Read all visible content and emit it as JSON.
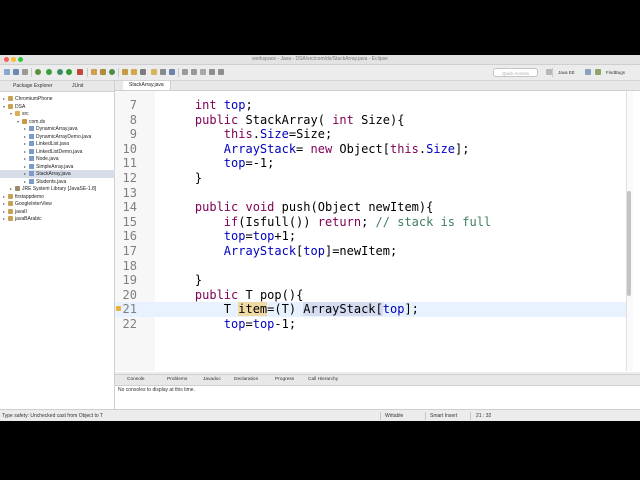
{
  "window": {
    "title": "workspace - Java - DSA/src/com/ds/StackArray.java - Eclipse",
    "quick_access_placeholder": "Quick Access",
    "perspectives": [
      "Java EE",
      "FindBugs"
    ]
  },
  "explorer": {
    "tabs": [
      "Package Explorer",
      "JUnit"
    ],
    "tree": [
      {
        "label": "ChromiumPhone",
        "level": 0,
        "kind": "project"
      },
      {
        "label": "DSA",
        "level": 0,
        "kind": "project"
      },
      {
        "label": "src",
        "level": 1,
        "kind": "folder"
      },
      {
        "label": "com.ds",
        "level": 2,
        "kind": "package"
      },
      {
        "label": "DynamicArray.java",
        "level": 3,
        "kind": "file"
      },
      {
        "label": "DynamicArrayDemo.java",
        "level": 3,
        "kind": "file"
      },
      {
        "label": "LinkedList.java",
        "level": 3,
        "kind": "file"
      },
      {
        "label": "LinkedListDemo.java",
        "level": 3,
        "kind": "file"
      },
      {
        "label": "Node.java",
        "level": 3,
        "kind": "file"
      },
      {
        "label": "SimpleArray.java",
        "level": 3,
        "kind": "file"
      },
      {
        "label": "StackArray.java",
        "level": 3,
        "kind": "file",
        "selected": true
      },
      {
        "label": "Students.java",
        "level": 3,
        "kind": "file"
      },
      {
        "label": "JRE System Library [JavaSE-1.8]",
        "level": 1,
        "kind": "library"
      },
      {
        "label": "firstappdemo",
        "level": 0,
        "kind": "project"
      },
      {
        "label": "GoogleInterView",
        "level": 0,
        "kind": "project"
      },
      {
        "label": "javaII",
        "level": 0,
        "kind": "project"
      },
      {
        "label": "javaBArabic",
        "level": 0,
        "kind": "project"
      }
    ]
  },
  "editor": {
    "tab": "StackArray.java",
    "lines": [
      {
        "n": "7",
        "code": [
          {
            "t": "    "
          },
          {
            "t": "int",
            "c": "kw"
          },
          {
            "t": " "
          },
          {
            "t": "top",
            "c": "fld"
          },
          {
            "t": ";"
          }
        ]
      },
      {
        "n": "8",
        "code": [
          {
            "t": "    "
          },
          {
            "t": "public",
            "c": "kw"
          },
          {
            "t": " StackArray( "
          },
          {
            "t": "int",
            "c": "kw"
          },
          {
            "t": " Size){"
          }
        ]
      },
      {
        "n": "9",
        "code": [
          {
            "t": "        "
          },
          {
            "t": "this",
            "c": "kw"
          },
          {
            "t": "."
          },
          {
            "t": "Size",
            "c": "fld"
          },
          {
            "t": "=Size;"
          }
        ]
      },
      {
        "n": "10",
        "code": [
          {
            "t": "        "
          },
          {
            "t": "ArrayStack",
            "c": "fld"
          },
          {
            "t": "= "
          },
          {
            "t": "new",
            "c": "kw"
          },
          {
            "t": " Object["
          },
          {
            "t": "this",
            "c": "kw"
          },
          {
            "t": "."
          },
          {
            "t": "Size",
            "c": "fld"
          },
          {
            "t": "];"
          }
        ]
      },
      {
        "n": "11",
        "code": [
          {
            "t": "        "
          },
          {
            "t": "top",
            "c": "fld"
          },
          {
            "t": "=-1;"
          }
        ]
      },
      {
        "n": "12",
        "code": [
          {
            "t": "    }"
          }
        ]
      },
      {
        "n": "13",
        "code": [
          {
            "t": ""
          }
        ]
      },
      {
        "n": "14",
        "code": [
          {
            "t": "    "
          },
          {
            "t": "public",
            "c": "kw"
          },
          {
            "t": " "
          },
          {
            "t": "void",
            "c": "kw"
          },
          {
            "t": " push(Object newItem){"
          }
        ]
      },
      {
        "n": "15",
        "code": [
          {
            "t": "        "
          },
          {
            "t": "if",
            "c": "kw"
          },
          {
            "t": "(Isfull()) "
          },
          {
            "t": "return",
            "c": "kw"
          },
          {
            "t": "; "
          },
          {
            "t": "// stack is full",
            "c": "cmt"
          }
        ]
      },
      {
        "n": "16",
        "code": [
          {
            "t": "        "
          },
          {
            "t": "top",
            "c": "fld"
          },
          {
            "t": "="
          },
          {
            "t": "top",
            "c": "fld"
          },
          {
            "t": "+1;"
          }
        ]
      },
      {
        "n": "17",
        "code": [
          {
            "t": "        "
          },
          {
            "t": "ArrayStack",
            "c": "fld"
          },
          {
            "t": "["
          },
          {
            "t": "top",
            "c": "fld"
          },
          {
            "t": "]=newItem;"
          }
        ]
      },
      {
        "n": "18",
        "code": [
          {
            "t": ""
          }
        ]
      },
      {
        "n": "19",
        "code": [
          {
            "t": "    }"
          }
        ]
      },
      {
        "n": "20",
        "code": [
          {
            "t": "    "
          },
          {
            "t": "public",
            "c": "kw"
          },
          {
            "t": " T pop(){"
          }
        ]
      },
      {
        "n": "21",
        "current": true,
        "code": [
          {
            "t": "        T "
          },
          {
            "t": "item",
            "c": "var-hl"
          },
          {
            "t": "=(T) "
          },
          {
            "t": "ArrayStack[",
            "c": "arr-hl"
          },
          {
            "t": "top",
            "c": "fld"
          },
          {
            "t": "];"
          }
        ]
      },
      {
        "n": "22",
        "code": [
          {
            "t": "        "
          },
          {
            "t": "top",
            "c": "fld"
          },
          {
            "t": "="
          },
          {
            "t": "top",
            "c": "fld"
          },
          {
            "t": "-1;"
          }
        ]
      }
    ]
  },
  "console": {
    "tabs": [
      "Console",
      "Problems",
      "Javadoc",
      "Declaration",
      "Progress",
      "Call Hierarchy"
    ],
    "message": "No consoles to display at this time."
  },
  "status": {
    "message": "Type safety: Unchecked cast from Object to T",
    "writable": "Writable",
    "insert_mode": "Smart Insert",
    "position": "21 : 32"
  },
  "colors": {
    "keyword": "#7f0055",
    "field": "#0000c0",
    "comment": "#3f7f5f",
    "current_line": "#e8f2fe"
  }
}
